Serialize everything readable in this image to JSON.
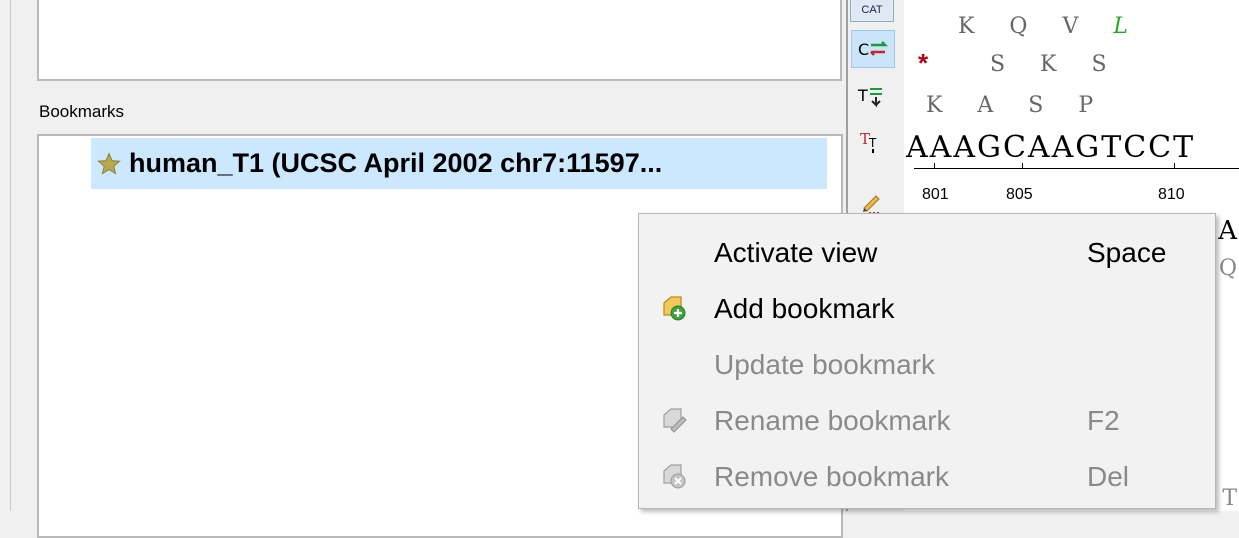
{
  "bookmarks": {
    "label": "Bookmarks",
    "items": [
      {
        "label": "human_T1 (UCSC April 2002 chr7:11597..."
      }
    ]
  },
  "toolbar": {
    "cat_label": "CAT",
    "c_label": "C",
    "t_label": "T",
    "tt_label": "T"
  },
  "sequence": {
    "aa_row1": "K  Q  V  ",
    "aa_row1_L": "L",
    "aa_row2": "S  K  S",
    "stop": "*",
    "aa_row3": "K  A  S  P",
    "dna": "AAAGCAAGTCCT",
    "ruler": [
      "801",
      "805",
      "810"
    ],
    "right_A": "A",
    "right_Q": "Q",
    "right_T": "T"
  },
  "context_menu": {
    "items": [
      {
        "label": "Activate view",
        "shortcut": "Space",
        "enabled": true,
        "icon": "none"
      },
      {
        "label": "Add bookmark",
        "shortcut": "",
        "enabled": true,
        "icon": "add-bookmark-icon"
      },
      {
        "label": "Update bookmark",
        "shortcut": "",
        "enabled": false,
        "icon": "none"
      },
      {
        "label": "Rename bookmark",
        "shortcut": "F2",
        "enabled": false,
        "icon": "rename-bookmark-icon"
      },
      {
        "label": "Remove bookmark",
        "shortcut": "Del",
        "enabled": false,
        "icon": "remove-bookmark-icon"
      }
    ]
  },
  "colors": {
    "selection": "#cce8ff",
    "menu_bg": "#f2f2f2",
    "disabled_text": "#8a8a8a",
    "stop_red": "#b0001a",
    "leucine_green": "#2aa52a"
  }
}
